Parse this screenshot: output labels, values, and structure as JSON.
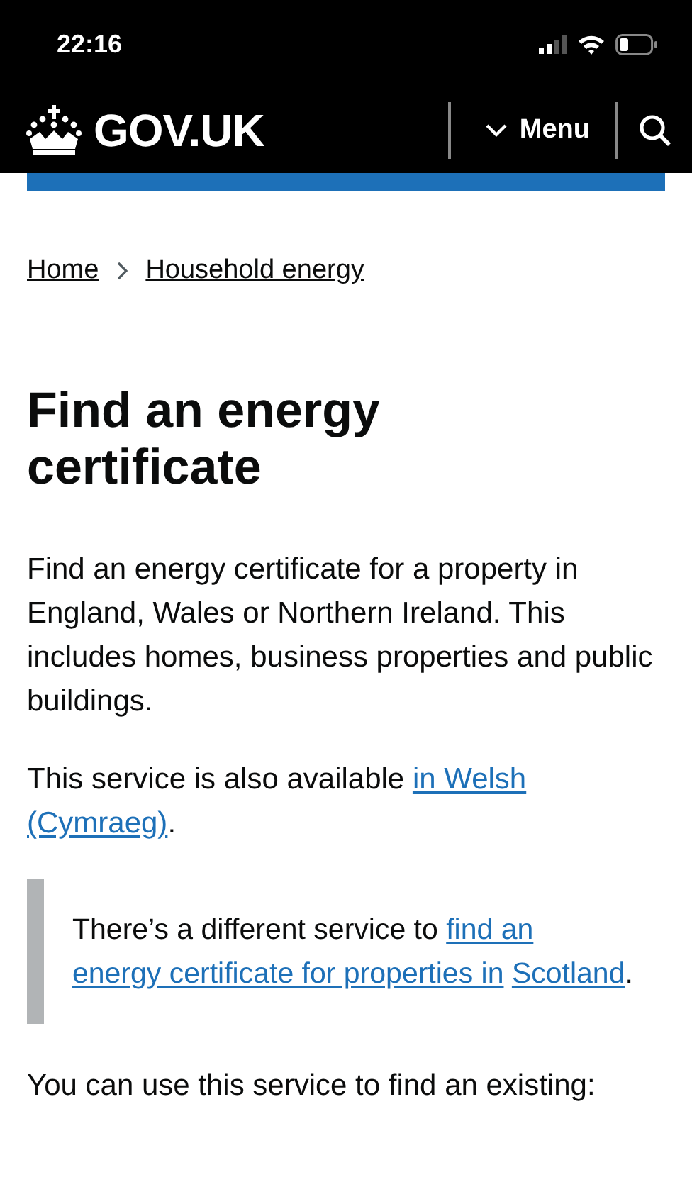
{
  "status_bar": {
    "time": "22:16"
  },
  "header": {
    "logo": "GOV.UK",
    "menu": "Menu"
  },
  "breadcrumbs": [
    {
      "label": "Home"
    },
    {
      "label": "Household energy"
    }
  ],
  "title": "Find an energy certificate",
  "paragraphs": [
    {
      "parts": [
        {
          "kind": "text",
          "text": "Find an energy certificate for a property in England, Wales or Northern Ireland. This includes homes, business properties and public buildings."
        }
      ]
    },
    {
      "parts": [
        {
          "kind": "text",
          "text": "This service is also available "
        },
        {
          "kind": "link",
          "lines": [
            "in Welsh",
            "(Cymraeg)"
          ]
        },
        {
          "kind": "text",
          "text": "."
        }
      ]
    }
  ],
  "inset": {
    "parts": [
      {
        "kind": "text",
        "text": "There’s a different service to "
      },
      {
        "kind": "link",
        "lines": [
          "find an",
          "energy certificate for properties in",
          "Scotland"
        ]
      },
      {
        "kind": "text",
        "text": "."
      }
    ]
  },
  "footer_text": "You can use this service to find an existing:"
}
